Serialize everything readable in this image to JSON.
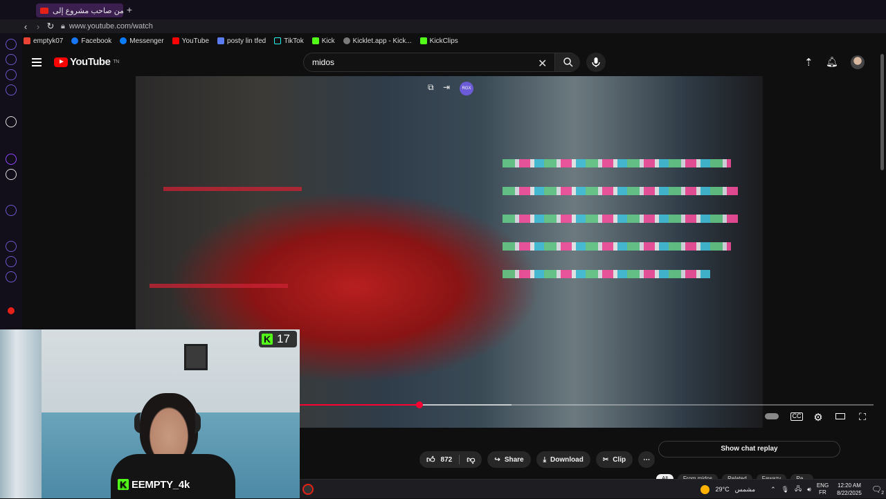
{
  "browser": {
    "tab_title": "تحدي من صاحب مشروع إلى...",
    "url": "www.youtube.com/watch",
    "bookmarks": [
      "emptyk07",
      "Facebook",
      "Messenger",
      "YouTube",
      "posty lin tfed",
      "TikTok",
      "Kick",
      "Kicklet.app - Kick...",
      "KickClips"
    ]
  },
  "youtube": {
    "logo_text": "YouTube",
    "region": "TN",
    "search_value": "midos"
  },
  "video": {
    "overlay_badge": "RGX",
    "progress_played": 0.21,
    "progress_buffered": 0.37
  },
  "webcam": {
    "kick_count": "17",
    "channel_name": "EEMPTY_4k"
  },
  "actions": {
    "likes": "872",
    "share": "Share",
    "download": "Download",
    "clip": "Clip",
    "chat_replay": "Show chat replay"
  },
  "chips": [
    "All",
    "From midos",
    "Related",
    "Fawazy",
    "Re..."
  ],
  "taskbar": {
    "temperature": "29°C",
    "weather": "مشمس",
    "lang": "ENG",
    "lang_sub": "FR",
    "time": "12:20 AM",
    "date": "8/22/2025",
    "notifications": "2"
  }
}
